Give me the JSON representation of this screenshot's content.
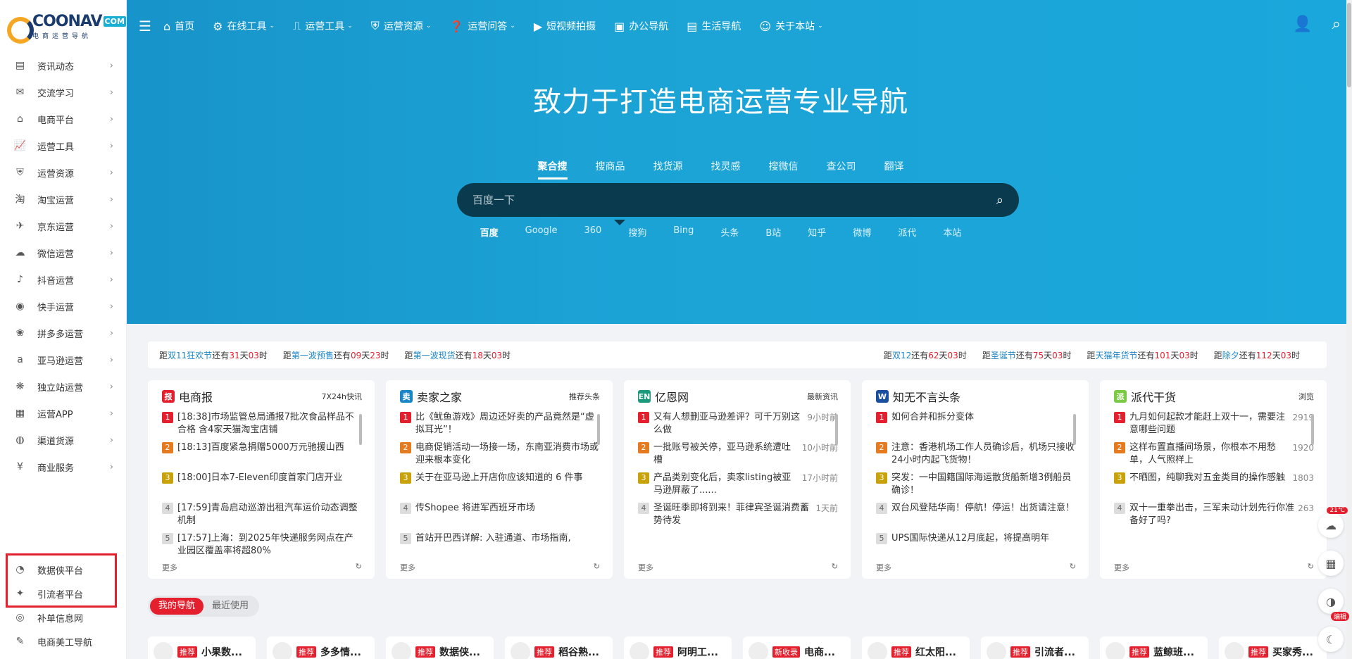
{
  "logo": {
    "main": "COONAV",
    "com": "COM",
    "sub": "电商运营导航"
  },
  "sidebar": {
    "items": [
      {
        "label": "资讯动态",
        "icon": "news-icon",
        "glyph": "▤"
      },
      {
        "label": "交流学习",
        "icon": "chat-icon",
        "glyph": "✉"
      },
      {
        "label": "电商平台",
        "icon": "shop-icon",
        "glyph": "⌂"
      },
      {
        "label": "运营工具",
        "icon": "chart-icon",
        "glyph": "📈"
      },
      {
        "label": "运营资源",
        "icon": "shield-icon",
        "glyph": "⛨"
      },
      {
        "label": "淘宝运营",
        "icon": "taobao-icon",
        "glyph": "淘"
      },
      {
        "label": "京东运营",
        "icon": "jd-icon",
        "glyph": "✈"
      },
      {
        "label": "微信运营",
        "icon": "wechat-icon",
        "glyph": "☁"
      },
      {
        "label": "抖音运营",
        "icon": "douyin-icon",
        "glyph": "♪"
      },
      {
        "label": "快手运营",
        "icon": "kuaishou-icon",
        "glyph": "◉"
      },
      {
        "label": "拼多多运营",
        "icon": "pdd-icon",
        "glyph": "❀"
      },
      {
        "label": "亚马逊运营",
        "icon": "amazon-icon",
        "glyph": "a"
      },
      {
        "label": "独立站运营",
        "icon": "site-icon",
        "glyph": "❋"
      },
      {
        "label": "运营APP",
        "icon": "app-icon",
        "glyph": "▦"
      },
      {
        "label": "渠道货源",
        "icon": "globe-icon",
        "glyph": "◍"
      },
      {
        "label": "商业服务",
        "icon": "money-icon",
        "glyph": "¥"
      }
    ],
    "bottom": [
      {
        "label": "数据侠平台",
        "icon": "data-icon",
        "glyph": "◔"
      },
      {
        "label": "引流者平台",
        "icon": "traffic-icon",
        "glyph": "✦"
      },
      {
        "label": "补单信息网",
        "icon": "order-icon",
        "glyph": "◎"
      },
      {
        "label": "电商美工导航",
        "icon": "design-icon",
        "glyph": "✎"
      }
    ]
  },
  "topnav": {
    "items": [
      {
        "label": "首页",
        "icon": "home-icon",
        "glyph": "⌂",
        "caret": false
      },
      {
        "label": "在线工具",
        "icon": "tools-icon",
        "glyph": "⚙",
        "caret": true
      },
      {
        "label": "运营工具",
        "icon": "chart-icon",
        "glyph": "⎍",
        "caret": true
      },
      {
        "label": "运营资源",
        "icon": "shield-icon",
        "glyph": "⛨",
        "caret": true
      },
      {
        "label": "运营问答",
        "icon": "qa-icon",
        "glyph": "❓",
        "caret": true
      },
      {
        "label": "短视频拍摄",
        "icon": "play-icon",
        "glyph": "▶",
        "caret": false
      },
      {
        "label": "办公导航",
        "icon": "office-icon",
        "glyph": "▣",
        "caret": false
      },
      {
        "label": "生活导航",
        "icon": "life-icon",
        "glyph": "▤",
        "caret": false
      },
      {
        "label": "关于本站",
        "icon": "users-icon",
        "glyph": "☺",
        "caret": true
      }
    ]
  },
  "hero": {
    "title": "致力于打造电商运营专业导航"
  },
  "search": {
    "tabs": [
      "聚合搜",
      "搜商品",
      "找货源",
      "找灵感",
      "搜微信",
      "查公司",
      "翻译"
    ],
    "active_tab": 0,
    "placeholder": "百度一下",
    "engines": [
      "百度",
      "Google",
      "360",
      "搜狗",
      "Bing",
      "头条",
      "B站",
      "知乎",
      "微博",
      "派代",
      "本站"
    ],
    "active_engine": 0
  },
  "countdown": [
    {
      "pre": "距",
      "event": "双11狂欢节",
      "mid": "还有",
      "d": "31",
      "h": "03"
    },
    {
      "pre": "距",
      "event": "第一波预售",
      "mid": "还有",
      "d": "09",
      "h": "23"
    },
    {
      "pre": "距",
      "event": "第一波现货",
      "mid": "还有",
      "d": "18",
      "h": "03"
    },
    {
      "pre": "距",
      "event": "双12",
      "mid": "还有",
      "d": "62",
      "h": "03"
    },
    {
      "pre": "距",
      "event": "圣诞节",
      "mid": "还有",
      "d": "75",
      "h": "03"
    },
    {
      "pre": "距",
      "event": "天猫年货节",
      "mid": "还有",
      "d": "101",
      "h": "03"
    },
    {
      "pre": "距",
      "event": "除夕",
      "mid": "还有",
      "d": "112",
      "h": "03"
    }
  ],
  "countdown_units": {
    "day": "天",
    "hour": "时"
  },
  "cards": [
    {
      "title": "电商报",
      "tag": "7X24h快讯",
      "logo_color": "#e5202e",
      "logo_glyph": "报",
      "more": "更多",
      "items": [
        {
          "text": "[18:38]市场监管总局通报7批次食品样品不合格 含4家天猫淘宝店铺",
          "time": ""
        },
        {
          "text": "[18:13]百度紧急捐赠5000万元驰援山西",
          "time": ""
        },
        {
          "text": "[18:00]日本7-Eleven印度首家门店开业",
          "time": ""
        },
        {
          "text": "[17:59]青岛启动巡游出租汽车运价动态调整机制",
          "time": ""
        },
        {
          "text": "[17:57]上海：到2025年快递服务网点在产业园区覆盖率将超80%",
          "time": ""
        }
      ]
    },
    {
      "title": "卖家之家",
      "tag": "推荐头条",
      "logo_color": "#1b86c7",
      "logo_glyph": "卖",
      "more": "更多",
      "items": [
        {
          "text": "比《鱿鱼游戏》周边还好卖的产品竟然是“虚拟耳光”！",
          "time": ""
        },
        {
          "text": "电商促销活动一场接一场，东南亚消费市场或迎来根本变化",
          "time": ""
        },
        {
          "text": "关于在亚马逊上开店你应该知道的 6 件事",
          "time": ""
        },
        {
          "text": "传Shopee 将进军西班牙市场",
          "time": ""
        },
        {
          "text": "首站开巴西详解: 入驻通道、市场指南,",
          "time": ""
        }
      ]
    },
    {
      "title": "亿恩网",
      "tag": "最新资讯",
      "logo_color": "#1a9a7a",
      "logo_glyph": "EN",
      "more": "更多",
      "items": [
        {
          "text": "又有人想删亚马逊差评？可千万别这么做",
          "time": "9小时前"
        },
        {
          "text": "一批账号被关停，亚马逊系统遭吐槽",
          "time": "10小时前"
        },
        {
          "text": "产品类别变化后，卖家listing被亚马逊屏蔽了......",
          "time": "17小时前"
        },
        {
          "text": "圣诞旺季即将到来！菲律宾圣诞消费蓄势待发",
          "time": "1天前"
        }
      ]
    },
    {
      "title": "知无不言头条",
      "tag": "",
      "logo_color": "#1a4fa0",
      "logo_glyph": "W",
      "more": "更多",
      "items": [
        {
          "text": "如何合并和拆分变体",
          "time": ""
        },
        {
          "text": "注意：香港机场工作人员确诊后，机场只接收24小时内起飞货物！",
          "time": ""
        },
        {
          "text": "突发：一中国籍国际海运散货船新增3例船员确诊！",
          "time": ""
        },
        {
          "text": "双台风登陆华南！停航！停运！出货请注意！",
          "time": ""
        },
        {
          "text": "UPS国际快递从12月底起，将提高明年",
          "time": ""
        }
      ]
    },
    {
      "title": "派代干货",
      "tag": "浏览",
      "logo_color": "#7ac943",
      "logo_glyph": "派",
      "more": "更多",
      "items": [
        {
          "text": "九月如何起款才能赶上双十一，需要注意哪些问题",
          "time": "2919"
        },
        {
          "text": "这样布置直播间场景，你根本不用愁单，人气照样上",
          "time": "1920"
        },
        {
          "text": "不晒图，纯聊我对五金类目的操作感触",
          "time": "1803"
        },
        {
          "text": "双十一重拳出击，三军未动计划先行你准备好了吗?",
          "time": "263"
        }
      ]
    }
  ],
  "mynav": {
    "tabs": [
      "我的导航",
      "最近使用"
    ],
    "active": 0
  },
  "sites": [
    {
      "badge": "推荐",
      "name": "小果数..."
    },
    {
      "badge": "推荐",
      "name": "多多情..."
    },
    {
      "badge": "推荐",
      "name": "数据侠..."
    },
    {
      "badge": "推荐",
      "name": "稻谷熟..."
    },
    {
      "badge": "推荐",
      "name": "阿明工..."
    },
    {
      "badge": "新收录",
      "name": "电商..."
    },
    {
      "badge": "推荐",
      "name": "红太阳..."
    },
    {
      "badge": "推荐",
      "name": "引流者..."
    },
    {
      "badge": "推荐",
      "name": "蓝鲸班..."
    },
    {
      "badge": "推荐",
      "name": "买家秀..."
    }
  ],
  "float": {
    "weather": "21℃",
    "edit": "编辑"
  }
}
